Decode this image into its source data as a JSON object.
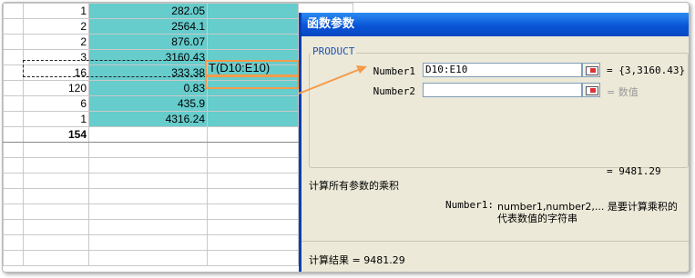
{
  "sheet": {
    "rows": [
      {
        "a": "1",
        "c": "282.05"
      },
      {
        "a": "2",
        "c": "2564.1"
      },
      {
        "a": "2",
        "c": "876.07"
      },
      {
        "a": "3",
        "c": "3160.43"
      },
      {
        "a": "16",
        "c": "333.38"
      },
      {
        "a": "120",
        "c": "0.83"
      },
      {
        "a": "6",
        "c": "435.9"
      },
      {
        "a": "1",
        "c": "4316.24"
      }
    ],
    "total": "154",
    "formula_fragment": "T(D10:E10)"
  },
  "dialog": {
    "title": "函数参数",
    "function_name": "PRODUCT",
    "args": [
      {
        "label": "Number1",
        "value": "D10:E10",
        "result": "= {3,3160.43}"
      },
      {
        "label": "Number2",
        "value": "",
        "result": "= 数值"
      }
    ],
    "formula_result": "= 9481.29",
    "description": "计算所有参数的乘积",
    "help_label": "Number1:",
    "help_text_1": "number1,number2,... 是要计算乘积的",
    "help_text_2": "代表数值的字符串",
    "result_label": "计算结果 = 9481.29"
  },
  "colors": {
    "accent": "#66cccc",
    "arrow": "#f49b4a",
    "title": "#0a55d8"
  }
}
